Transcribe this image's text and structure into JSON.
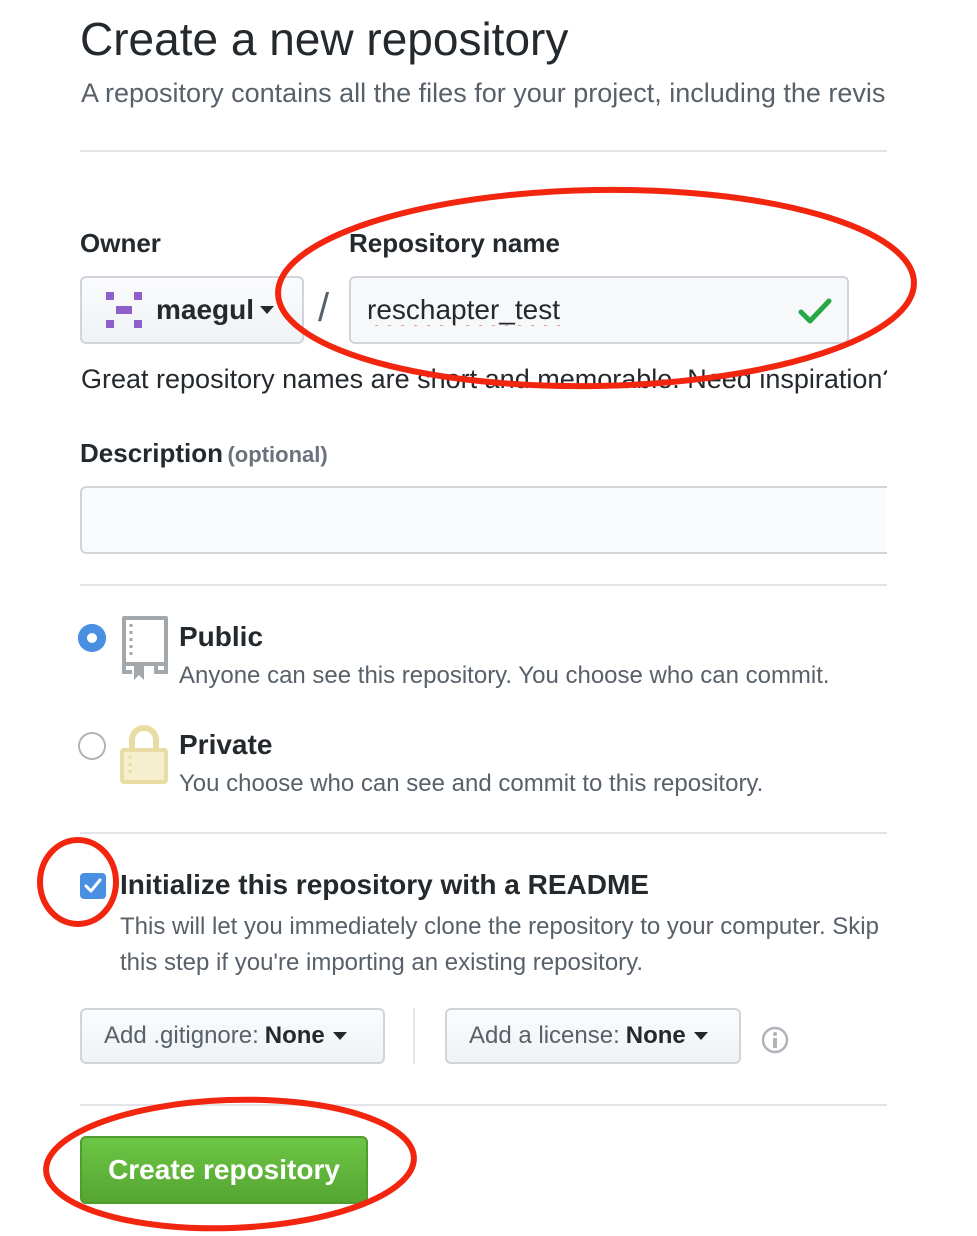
{
  "header": {
    "title": "Create a new repository",
    "subtitle": "A repository contains all the files for your project, including the revision history."
  },
  "owner": {
    "label": "Owner",
    "value": "maegul"
  },
  "repo_name": {
    "label": "Repository name",
    "value": "reschapter_test",
    "separator": "/",
    "hint": "Great repository names are short and memorable. Need inspiration?"
  },
  "description": {
    "label": "Description",
    "optional": "(optional)",
    "value": ""
  },
  "visibility": {
    "public": {
      "title": "Public",
      "desc": "Anyone can see this repository. You choose who can commit.",
      "selected": true
    },
    "private": {
      "title": "Private",
      "desc": "You choose who can see and commit to this repository.",
      "selected": false
    }
  },
  "readme": {
    "label": "Initialize this repository with a README",
    "desc": "This will let you immediately clone the repository to your computer. Skip this step if you're importing an existing repository.",
    "checked": true
  },
  "gitignore": {
    "label": "Add .gitignore:",
    "value": "None"
  },
  "license": {
    "label": "Add a license:",
    "value": "None"
  },
  "create_button": "Create repository",
  "colors": {
    "accent_blue": "#4a90e2",
    "success_green": "#28a745",
    "create_green": "#55a532",
    "annotation_red": "#f2250f",
    "private_icon": "#e9dca3"
  },
  "icons": {
    "owner_avatar": "identicon",
    "valid_name": "checkmark-icon",
    "public": "repo-book-icon",
    "private": "lock-icon",
    "info": "info-icon"
  }
}
